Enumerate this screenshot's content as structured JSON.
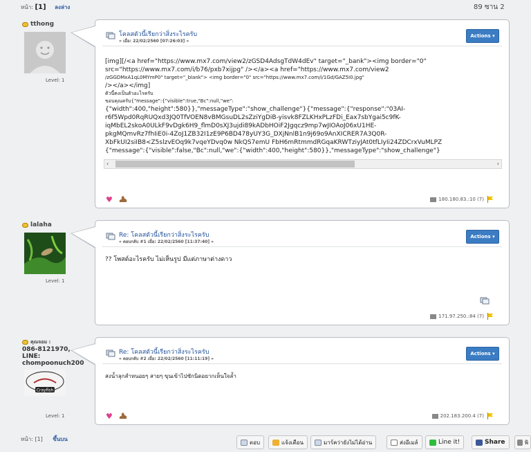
{
  "top": {
    "page_label": "หน้า:",
    "page_current": "[1]",
    "down_link": "ลงล่าง",
    "count": "89 ซาน   2"
  },
  "posts": [
    {
      "user": {
        "name": "tthong",
        "level": "Level: 1"
      },
      "title": "โคลสตัวนี้เรียกว่าสิ่งระไรครับ",
      "meta": "« เมื่อ: 22/02/2560 [07:26:03] »",
      "actions": "Actions",
      "body": [
        "[img][/<a href=\"https://www.mx7.com/view2/zGSD4AdsgTdW4dEv\" target=\"_bank\"><img border=\"0\"",
        "src=\"https://www.mx7.com/i/b76/pxb7xijpg\" /></a><a href=\"https://www.mx7.com/view2",
        "/zGGDMxA1qL0MYmP0\" target=\"_blank\"> <img border=\"0\" src=\"https://www.mx7.com/i/1Gd/GAZ5I0.jpg\"",
        "/></a></img]"
      ],
      "body_thai": "ตัวนี้คงเป็นตัวอะไรครับ",
      "body2": [
        "ขอบคุณครับ{\"message\":{\"visible\":true,\"Bc\":null,\"we\":",
        "{\"width\":400,\"height\":580}},\"messageType\":\"show_challenge\"}{\"message\":{\"response\":\"03AI-",
        "r6f5Wpd0RqRUQxd3JQ0TfVOEN8vBMGsuDL2sZziYgDiB-yisvk8FZLKHxPLzFDi_Eax7sbYgai5c9fK-",
        "iqMbEL2skoA0ULkF9vDgk6H9_flmD0sXJ3ujdi89kADbHOiF2Jgqcz9mp7wJIOAoJ06xU1HE-",
        "pkgMQmvRz7fhIiE0i-4ZoJ1ZB32I1zE9P6BD478yUY3G_DXjNnlB1n9j69o9AnXICRER7A3Q0R-",
        "XbFkUI2siIB8<Z5slzvEOq9k7vqeYDvq0w  NkQS7emU  FbH6mRtmmdRGqaKRWTziyJAt0tfLIyIi24ZDCrxVuMLPZ",
        "{\"message\":{\"visible\":false,\"Bc\":null,\"we\":{\"width\":400,\"height\":580}},\"messageType\":\"show_challenge\"}"
      ],
      "ip": "180.180.83.:10 (7)"
    },
    {
      "user": {
        "name": "lalaha",
        "level": "Level: 1"
      },
      "title": "Re: โคลสตัวนี้เรียกว่าสิ่งระไรครับ",
      "meta": "« ตอบกลับ #1 เมื่อ: 22/02/2560 [11:37:40] »",
      "actions": "Actions",
      "body": [
        "?? โพสต์อะไรครับ ไม่เห็นรูป มีแต่ภาษาต่างดาว"
      ],
      "ip": "171.97.250.:84 (7)"
    },
    {
      "user": {
        "name": "คุณจอม :",
        "phone": "086-8121970,",
        "line": "LINE:",
        "line_id": "chompoonuch200",
        "level": "Level: 1",
        "avatar_text": "Crayfish"
      },
      "title": "Re: โคลสตัวนี้เรียกว่าสิ่งระไรครับ",
      "meta": "« ตอบกลับ #2 เมื่อ: 22/02/2560 [11:11:19] »",
      "actions": "Actions",
      "body": [
        "สงน้ำลุกสำหนอยๆ สายๆ  ขุนเข้าไปซักนิดอยากเห็นใจล้ำ"
      ],
      "ip": "202.183.200.4 (7)"
    }
  ],
  "bottom": {
    "page_label": "หน้า: [1]",
    "up_link": "ขึ้นบน",
    "buttons": [
      "ตอบ",
      "แจ้งเตือน",
      "มาร์คว่ายังไม่ได้อ่าน",
      "ส่งอีเมล์",
      "Line it!",
      "Share",
      "พิ"
    ]
  },
  "colors": {
    "accent": "#3b7cc3",
    "link": "#1f4f9a",
    "background": "#eef0f2"
  }
}
